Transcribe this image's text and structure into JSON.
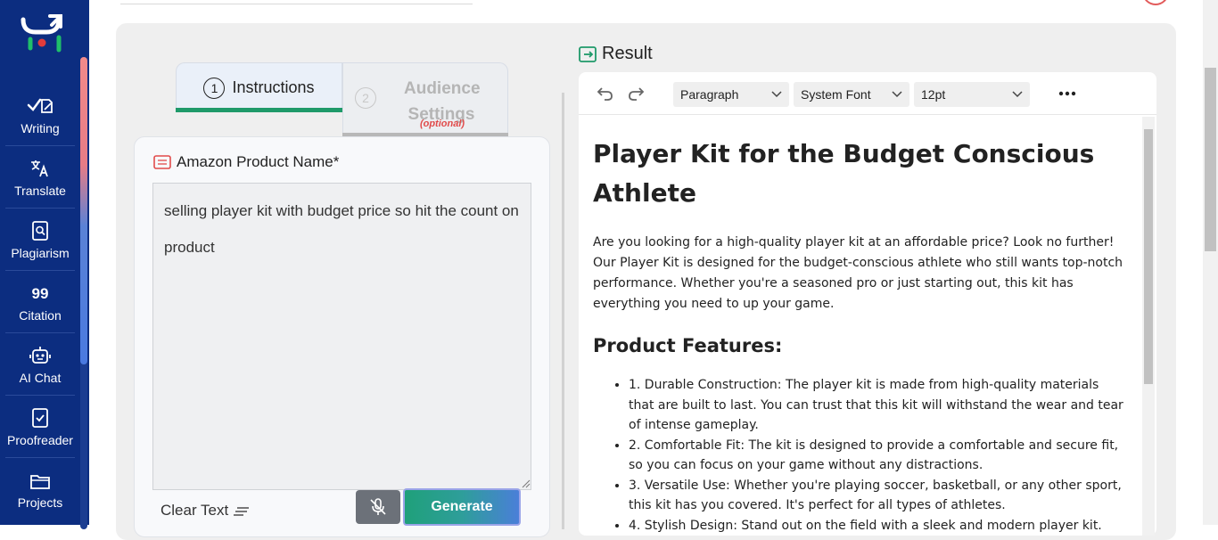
{
  "sidebar": {
    "items": [
      {
        "label": "Writing",
        "icon": "pen-check-icon"
      },
      {
        "label": "Translate",
        "icon": "translate-icon"
      },
      {
        "label": "Plagiarism",
        "icon": "document-search-icon"
      },
      {
        "label": "Citation",
        "icon": "quote-icon",
        "glyph": "99"
      },
      {
        "label": "AI Chat",
        "icon": "robot-icon"
      },
      {
        "label": "Proofreader",
        "icon": "document-check-icon"
      },
      {
        "label": "Projects",
        "icon": "folder-icon"
      }
    ]
  },
  "tabs": {
    "instructions": {
      "number": "1",
      "label": "Instructions"
    },
    "audience": {
      "number": "2",
      "label": "Audience Settings",
      "optional": "(optional)"
    }
  },
  "form": {
    "field_label": "Amazon Product Name*",
    "value": "selling player kit with budget price so hit the count on product",
    "clear_label": "Clear Text",
    "generate_label": "Generate"
  },
  "result": {
    "heading": "Result",
    "toolbar": {
      "block_format": "Paragraph",
      "font_family": "System Font",
      "font_size": "12pt"
    },
    "document": {
      "title": "Player Kit for the Budget Conscious Athlete",
      "intro": "Are you looking for a high-quality player kit at an affordable price? Look no further! Our Player Kit is designed for the budget-conscious athlete who still wants top-notch performance. Whether you're a seasoned pro or just starting out, this kit has everything you need to up your game.",
      "features_heading": "Product Features:",
      "features": [
        "1. Durable Construction: The player kit is made from high-quality materials that are built to last. You can trust that this kit will withstand the wear and tear of intense gameplay.",
        "2. Comfortable Fit: The kit is designed to provide a comfortable and secure fit, so you can focus on your game without any distractions.",
        "3. Versatile Use: Whether you're playing soccer, basketball, or any other sport, this kit has you covered. It's perfect for all types of athletes.",
        "4. Stylish Design: Stand out on the field with a sleek and modern player kit."
      ]
    }
  },
  "colors": {
    "sidebar_bg": "#0c2d80",
    "accent_green": "#1f9a6a",
    "optional_red": "#e14b4b"
  }
}
